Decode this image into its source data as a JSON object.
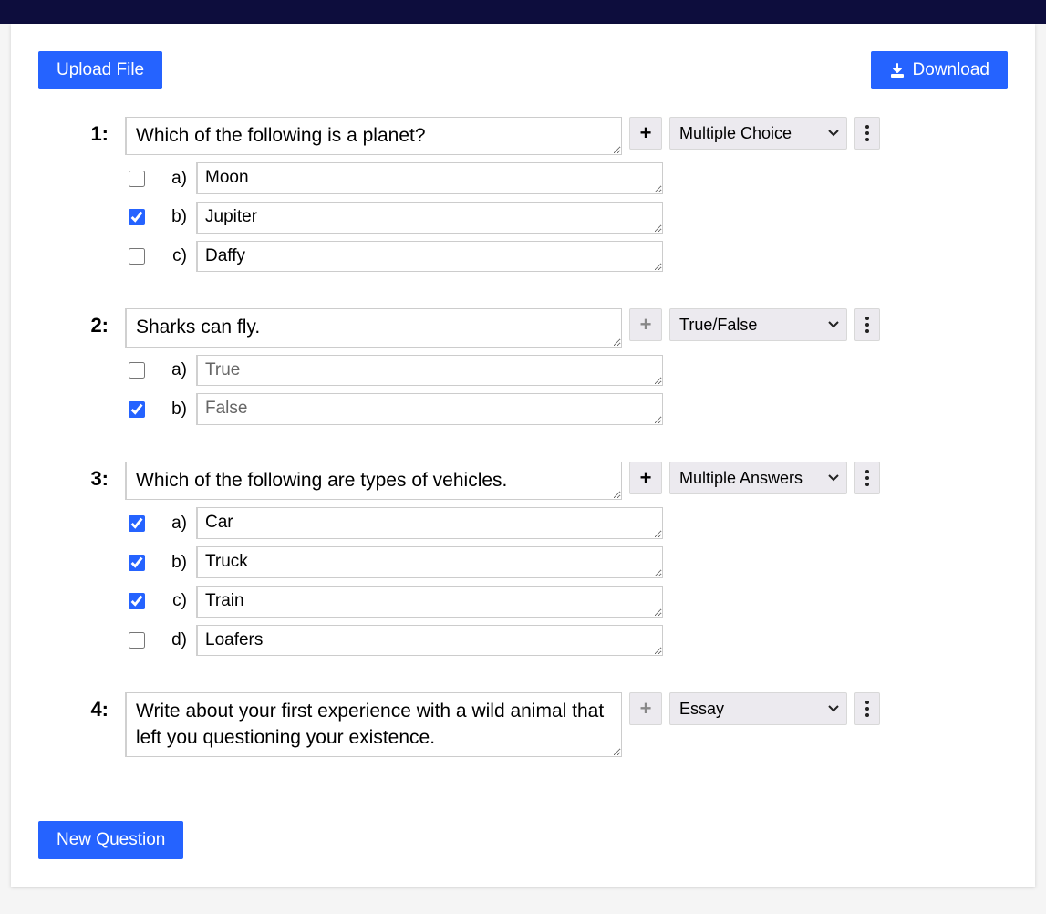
{
  "buttons": {
    "upload": "Upload File",
    "download": "Download",
    "new_question": "New Question"
  },
  "question_types": [
    "Multiple Choice",
    "True/False",
    "Multiple Answers",
    "Essay"
  ],
  "questions": [
    {
      "number": "1:",
      "text": "Which of the following is a planet?",
      "type": "Multiple Choice",
      "add_enabled": true,
      "answers": [
        {
          "letter": "a)",
          "text": "Moon",
          "placeholder": "",
          "checked": false
        },
        {
          "letter": "b)",
          "text": "Jupiter",
          "placeholder": "",
          "checked": true
        },
        {
          "letter": "c)",
          "text": "Daffy",
          "placeholder": "",
          "checked": false
        }
      ]
    },
    {
      "number": "2:",
      "text": "Sharks can fly.",
      "type": "True/False",
      "add_enabled": false,
      "answers": [
        {
          "letter": "a)",
          "text": "",
          "placeholder": "True",
          "checked": false
        },
        {
          "letter": "b)",
          "text": "",
          "placeholder": "False",
          "checked": true
        }
      ]
    },
    {
      "number": "3:",
      "text": "Which of the following are types of vehicles.",
      "type": "Multiple Answers",
      "add_enabled": true,
      "answers": [
        {
          "letter": "a)",
          "text": "Car",
          "placeholder": "",
          "checked": true
        },
        {
          "letter": "b)",
          "text": "Truck",
          "placeholder": "",
          "checked": true
        },
        {
          "letter": "c)",
          "text": "Train",
          "placeholder": "",
          "checked": true
        },
        {
          "letter": "d)",
          "text": "Loafers",
          "placeholder": "",
          "checked": false
        }
      ]
    },
    {
      "number": "4:",
      "text": "Write about your first experience with a wild animal that left you questioning your existence.",
      "type": "Essay",
      "add_enabled": false,
      "answers": []
    }
  ]
}
